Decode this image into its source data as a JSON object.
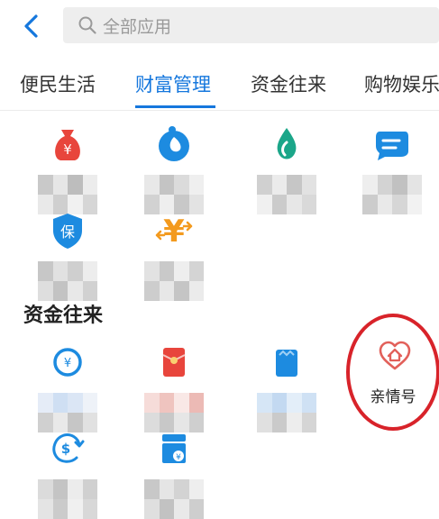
{
  "search": {
    "placeholder": "全部应用"
  },
  "tabs": [
    {
      "label": "便民生活"
    },
    {
      "label": "财富管理"
    },
    {
      "label": "资金往来"
    },
    {
      "label": "购物娱乐"
    }
  ],
  "active_tab": "财富管理",
  "sections": [
    {
      "title": "资金往来"
    }
  ],
  "highlighted_app": {
    "label": "亲情号"
  },
  "colors": {
    "accent": "#1577dd",
    "highlight_ring": "#d8232a",
    "icon_red": "#e8453c",
    "icon_blue": "#1d8be0",
    "icon_teal": "#1ba689",
    "icon_orange": "#f39a1e"
  }
}
